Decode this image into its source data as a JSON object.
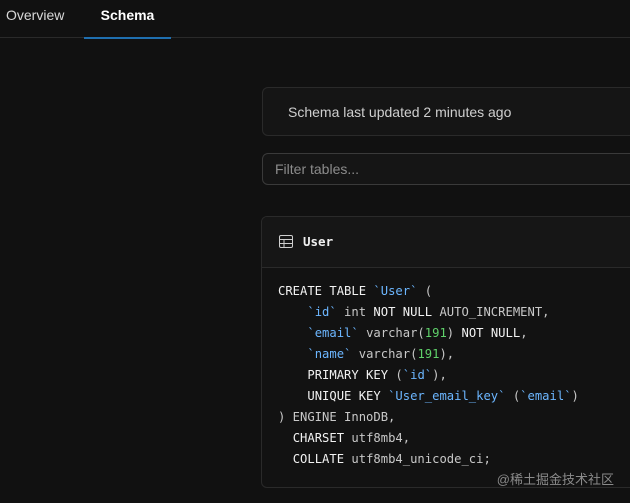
{
  "tabs": {
    "overview": "Overview",
    "schema": "Schema"
  },
  "notice": {
    "text": "Schema last updated 2 minutes ago"
  },
  "filter": {
    "placeholder": "Filter tables..."
  },
  "table_card": {
    "icon": "table-grid-icon",
    "title": "User",
    "code": {
      "line1": {
        "kw": "CREATE TABLE",
        "name": "`User`",
        "rest": " ("
      },
      "line2": {
        "name": "`id`",
        "type": " int ",
        "kw": "NOT NULL",
        "rest": " AUTO_INCREMENT,"
      },
      "line3": {
        "name": "`email`",
        "type_pre": " varchar(",
        "num": "191",
        "type_post": ") ",
        "kw": "NOT NULL",
        "rest": ","
      },
      "line4": {
        "name": "`name`",
        "type_pre": " varchar(",
        "num": "191",
        "type_post": "),"
      },
      "line5": {
        "kw": "PRIMARY KEY",
        "pre": " (",
        "name": "`id`",
        "post": "),"
      },
      "line6": {
        "kw": "UNIQUE KEY",
        "sp": " ",
        "name": "`User_email_key`",
        "pre": " (",
        "col": "`email`",
        "post": ")"
      },
      "line7": ") ENGINE InnoDB,",
      "line8": {
        "kw": "CHARSET",
        "rest": " utf8mb4,"
      },
      "line9": {
        "kw": "COLLATE",
        "rest": " utf8mb4_unicode_ci;"
      }
    }
  },
  "watermark": "@稀土掘金技术社区",
  "colors": {
    "background": "#111111",
    "active_tab_underline": "#1f6fb0",
    "identifier": "#6cb6ff",
    "number": "#5fd16a"
  }
}
